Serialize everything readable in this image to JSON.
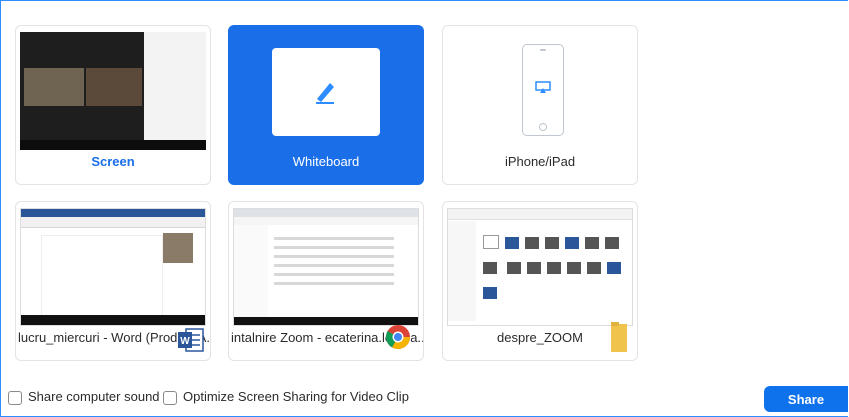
{
  "tiles": [
    {
      "label": "Screen",
      "icon": "screen-thumbnail"
    },
    {
      "label": "Whiteboard",
      "icon": "pen-icon",
      "selected": true
    },
    {
      "label": "iPhone/iPad",
      "icon": "airplay-icon"
    },
    {
      "label": "lucru_miercuri - Word (Product A...",
      "icon": "word-icon"
    },
    {
      "label": "intalnire Zoom - ecaterina.lomba...",
      "icon": "chrome-icon"
    },
    {
      "label": "despre_ZOOM",
      "icon": "folder-icon"
    }
  ],
  "footer": {
    "share_sound": "Share computer sound",
    "optimize_video": "Optimize Screen Sharing for Video Clip",
    "share_button": "Share"
  },
  "colors": {
    "accent": "#1a6fe8",
    "button": "#0e72ed"
  }
}
